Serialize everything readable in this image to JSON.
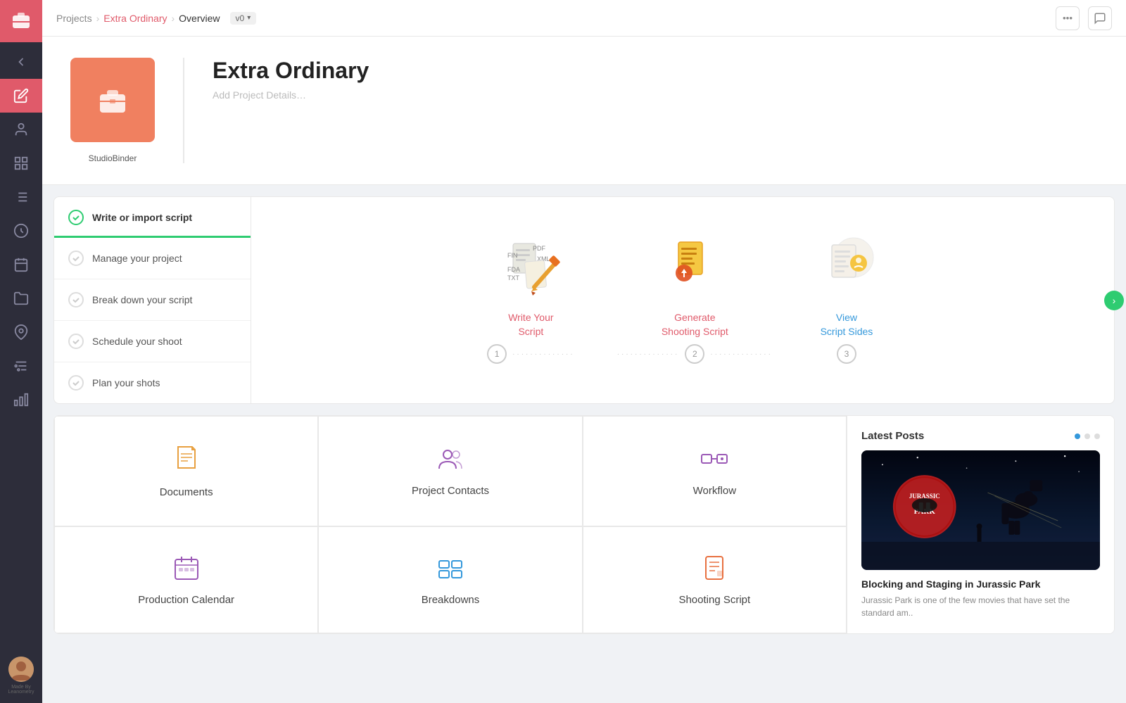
{
  "sidebar": {
    "logo_icon": "💬",
    "items": [
      {
        "id": "back",
        "icon": "←",
        "label": "back",
        "active": false
      },
      {
        "id": "scripts",
        "icon": "✏",
        "label": "scripts",
        "active": true
      },
      {
        "id": "contacts",
        "icon": "👤",
        "label": "contacts",
        "active": false
      },
      {
        "id": "storyboard",
        "icon": "⊞",
        "label": "storyboard",
        "active": false
      },
      {
        "id": "breakdown",
        "icon": "≡",
        "label": "breakdown",
        "active": false
      },
      {
        "id": "scenes",
        "icon": "⊙",
        "label": "scenes",
        "active": false
      },
      {
        "id": "calendar",
        "icon": "📅",
        "label": "calendar",
        "active": false
      },
      {
        "id": "folders",
        "icon": "📁",
        "label": "folders",
        "active": false
      },
      {
        "id": "locations",
        "icon": "📍",
        "label": "locations",
        "active": false
      },
      {
        "id": "filters",
        "icon": "⚙",
        "label": "filters",
        "active": false
      },
      {
        "id": "analytics",
        "icon": "📊",
        "label": "analytics",
        "active": false
      }
    ]
  },
  "topbar": {
    "breadcrumb": {
      "projects": "Projects",
      "sep1": "›",
      "project": "Extra Ordinary",
      "sep2": "›",
      "current": "Overview"
    },
    "version": "v0",
    "more_label": "•••",
    "chat_label": "💬"
  },
  "project": {
    "title": "Extra Ordinary",
    "subtitle": "Add Project Details…",
    "thumbnail_label": "StudioBinder"
  },
  "steps": {
    "list": [
      {
        "id": "write",
        "label": "Write or import script",
        "done": true,
        "active": true
      },
      {
        "id": "manage",
        "label": "Manage your project",
        "done": false,
        "active": false
      },
      {
        "id": "breakdown",
        "label": "Break down your script",
        "done": false,
        "active": false
      },
      {
        "id": "schedule",
        "label": "Schedule your shoot",
        "done": false,
        "active": false
      },
      {
        "id": "shots",
        "label": "Plan your shots",
        "done": false,
        "active": false
      }
    ],
    "actions": [
      {
        "id": "write-script",
        "label": "Write Your\nScript",
        "number": "1"
      },
      {
        "id": "generate-shooting",
        "label": "Generate\nShooting Script",
        "number": "2"
      },
      {
        "id": "view-sides",
        "label": "View\nScript Sides",
        "number": "3"
      }
    ]
  },
  "grid": {
    "cells": [
      {
        "id": "documents",
        "label": "Documents",
        "icon": "pencil"
      },
      {
        "id": "project-contacts",
        "label": "Project Contacts",
        "icon": "contacts"
      },
      {
        "id": "workflow",
        "label": "Workflow",
        "icon": "workflow"
      },
      {
        "id": "production-calendar",
        "label": "Production Calendar",
        "icon": "calendar"
      },
      {
        "id": "breakdowns",
        "label": "Breakdowns",
        "icon": "breakdown"
      },
      {
        "id": "shooting-script",
        "label": "Shooting Script",
        "icon": "script"
      }
    ]
  },
  "latest_posts": {
    "title": "Latest Posts",
    "post": {
      "title": "Blocking and Staging in Jurassic Park",
      "excerpt": "Jurassic Park is one of the few movies that have set the standard am.."
    },
    "dots": [
      true,
      false,
      false
    ]
  }
}
